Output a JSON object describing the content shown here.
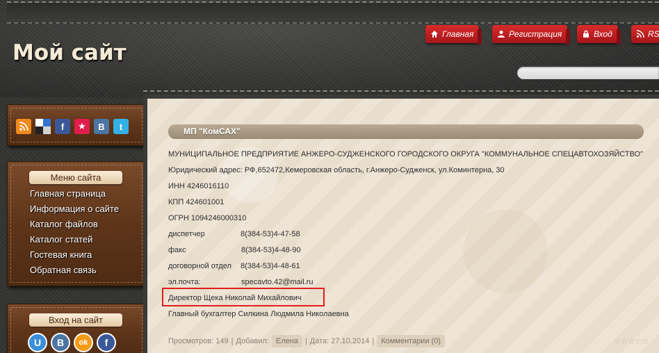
{
  "header": {
    "site_title": "Мой сайт",
    "nav": [
      {
        "label": "Главная",
        "icon": "home-icon"
      },
      {
        "label": "Регистрация",
        "icon": "user-icon"
      },
      {
        "label": "Вход",
        "icon": "lock-icon"
      },
      {
        "label": "RSS",
        "icon": "rss-icon"
      }
    ]
  },
  "sidebar": {
    "social_icons": [
      "rss-icon",
      "delicious-icon",
      "facebook-icon",
      "bookmark-star-icon",
      "vk-icon",
      "twitter-icon"
    ],
    "menu_title": "Меню сайта",
    "menu_items": [
      "Главная страница",
      "Информация о сайте",
      "Каталог файлов",
      "Каталог статей",
      "Гостевая книга",
      "Обратная связь"
    ],
    "login_title": "Вход на сайт",
    "login_icons": [
      {
        "name": "ucoz-login-icon",
        "glyph": "U"
      },
      {
        "name": "vk-login-icon",
        "glyph": "B"
      },
      {
        "name": "odnoklassniki-login-icon",
        "glyph": "ok"
      },
      {
        "name": "facebook-login-icon",
        "glyph": "f"
      }
    ]
  },
  "entry": {
    "title": "МП \"КомСАХ\"",
    "full_name": "МУНИЦИПАЛЬНОЕ ПРЕДПРИЯТИЕ АНЖЕРО-СУДЖЕНСКОГО ГОРОДСКОГО ОКРУГА \"КОММУНАЛЬНОЕ СПЕЦАВТОХОЗЯЙСТВО\"",
    "address": "Юридический адрес: РФ,652472,Кемеровская область, г.Анжеро-Судженск, ул.Коминтерна, 30",
    "inn": "ИНН 4246016110",
    "kpp": "КПП 424601001",
    "ogrn": "ОГРН 1094246000310",
    "contacts": [
      {
        "label": "диспетчер",
        "value": "8(384-53)4-47-58"
      },
      {
        "label": "факс",
        "value": "8(384-53)4-48-90"
      },
      {
        "label": "договорной отдел",
        "value": "8(384-53)4-48-61"
      },
      {
        "label": "эл.почта:",
        "value": "specavto.42@mail.ru"
      }
    ],
    "director": "Директор Щека Николай Михайлович",
    "accountant": "Главный бухгалтер Силкина Людмила Николаевна"
  },
  "footer": {
    "views": "Просмотров: 149",
    "added_by_label": "Добавил:",
    "author": "Елена",
    "date": "Дата: 27.10.2014",
    "comments": "Комментарии (0)",
    "separator": "|"
  }
}
